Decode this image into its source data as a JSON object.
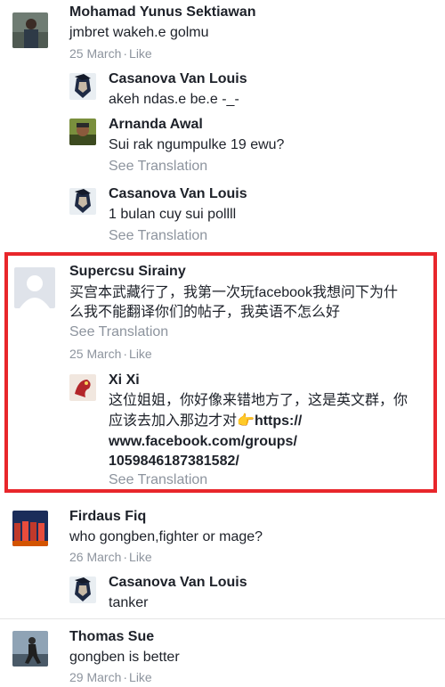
{
  "comments": [
    {
      "name": "Mohamad Yunus Sektiawan",
      "text": "jmbret wakeh.e golmu",
      "date": "25 March",
      "like": "Like"
    },
    {
      "name": "Casanova Van Louis",
      "text": "akeh ndas.e be.e -_-"
    },
    {
      "name": "Arnanda Awal",
      "text": "Sui rak ngumpulke 19 ewu?",
      "see_translation": "See Translation"
    },
    {
      "name": "Casanova Van Louis",
      "text": "1 bulan cuy sui pollll",
      "see_translation": "See Translation"
    },
    {
      "name": "Supercsu Sirainy",
      "text_line1": "买宫本武藏行了，我第一次玩facebook我想问下为什",
      "text_line2": "么我不能翻译你们的帖子，我英语不怎么好",
      "see_translation": "See Translation",
      "date": "25 March",
      "like": "Like"
    },
    {
      "name": "Xi Xi",
      "text_line1": "这位姐姐，你好像来错地方了，这是英文群，你",
      "text_line2": "应该去加入那边才对",
      "link_part1": "https://",
      "link_part2": "www.facebook.com/groups/",
      "link_part3": "1059846187381582/",
      "see_translation": "See Translation"
    },
    {
      "name": "Firdaus Fiq",
      "text": "who gongben,fighter or mage?",
      "date": "26 March",
      "like": "Like"
    },
    {
      "name": "Casanova Van Louis",
      "text": "tanker"
    },
    {
      "name": "Thomas Sue",
      "text": "gongben is better",
      "date": "29 March",
      "like": "Like"
    }
  ],
  "separator": "·",
  "colors": {
    "highlight_border": "#e8262b",
    "meta_text": "#8d949e"
  }
}
